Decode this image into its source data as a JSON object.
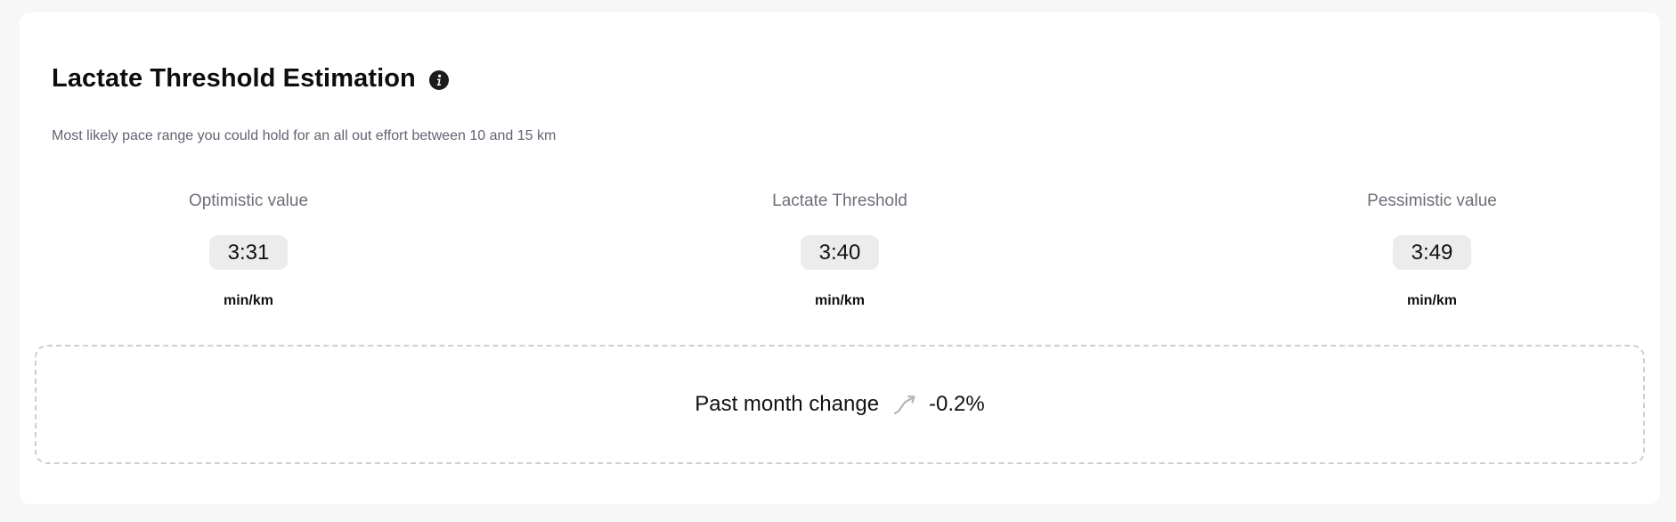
{
  "card": {
    "title": "Lactate Threshold Estimation",
    "info_icon": "info-icon",
    "subtitle": "Most likely pace range you could hold for an all out effort between 10 and 15 km"
  },
  "estimates": [
    {
      "label": "Optimistic value",
      "value": "3:31",
      "unit": "min/km"
    },
    {
      "label": "Lactate Threshold",
      "value": "3:40",
      "unit": "min/km"
    },
    {
      "label": "Pessimistic value",
      "value": "3:49",
      "unit": "min/km"
    }
  ],
  "change": {
    "label": "Past month change",
    "trend_icon": "trend-up-arrow-icon",
    "value": "-0.2%"
  },
  "colors": {
    "page_background": "#f7f7f7",
    "card_background": "#ffffff",
    "chip_background": "#ececec",
    "muted_text": "#6b6f78",
    "dashed_border": "#cfcfcf",
    "trend_icon": "#b5b5b5"
  }
}
